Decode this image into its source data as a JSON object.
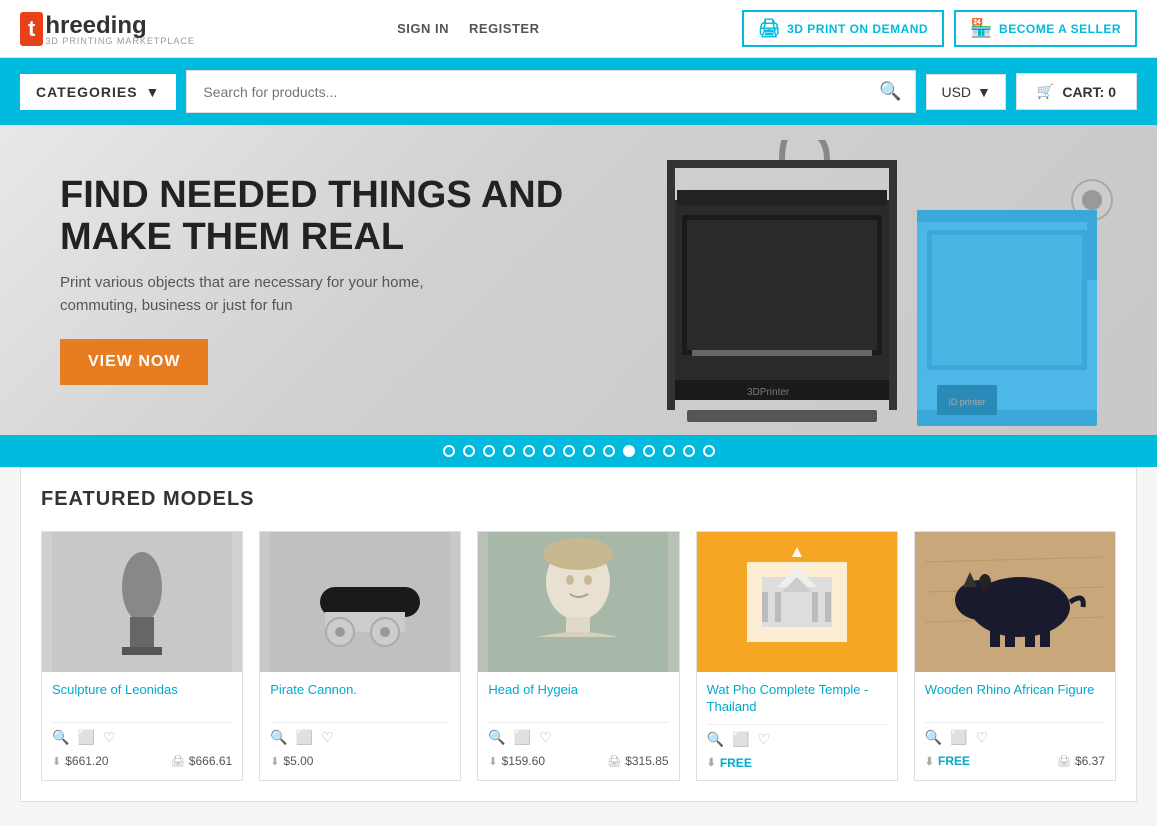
{
  "header": {
    "logo_letter": "t",
    "logo_name": "hreeding",
    "logo_sub": "3D PRINTING MARKETPLACE",
    "nav": {
      "signin": "SIGN IN",
      "register": "REGISTER"
    },
    "actions": {
      "print_label": "3D PRINT ON DEMAND",
      "seller_label": "BECOME A SELLER"
    }
  },
  "searchbar": {
    "categories_label": "CATEGORIES",
    "search_placeholder": "Search for products...",
    "currency": "USD",
    "cart_label": "CART: 0"
  },
  "hero": {
    "title": "FIND NEEDED THINGS AND MAKE THEM REAL",
    "subtitle": "Print various objects that are necessary for your home, commuting, business or just for fun",
    "cta": "VIEW NOW"
  },
  "carousel": {
    "dots": [
      0,
      1,
      2,
      3,
      4,
      5,
      6,
      7,
      8,
      9,
      10,
      11,
      12,
      13
    ],
    "active_index": 9
  },
  "featured": {
    "title": "FEATURED MODELS",
    "models": [
      {
        "id": "leonidas",
        "name": "Sculpture of Leonidas",
        "price_download": "$661.20",
        "price_print": "$666.61",
        "bg": "leonidas"
      },
      {
        "id": "cannon",
        "name": "Pirate Cannon.",
        "price_download": "$5.00",
        "price_print": null,
        "bg": "cannon"
      },
      {
        "id": "hygeia",
        "name": "Head of Hygeia",
        "price_download": "$159.60",
        "price_print": "$315.85",
        "bg": "hygeia"
      },
      {
        "id": "temple",
        "name": "Wat Pho Complete Temple - Thailand",
        "price_download": "FREE",
        "price_print": null,
        "bg": "temple"
      },
      {
        "id": "rhino",
        "name": "Wooden Rhino African Figure",
        "price_download": "FREE",
        "price_print": "$6.37",
        "bg": "rhino"
      }
    ]
  }
}
